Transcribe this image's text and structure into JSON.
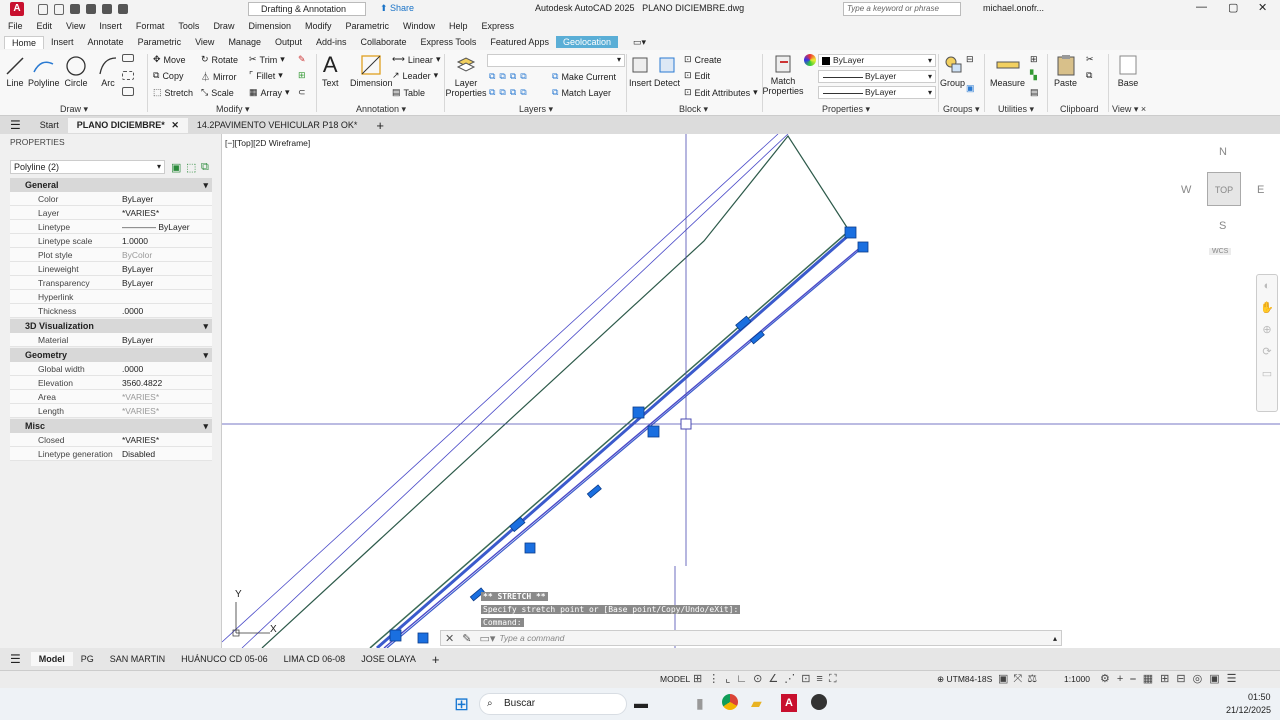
{
  "title": {
    "app_title": "Autodesk AutoCAD 2025",
    "file_name": "PLANO DICIEMBRE.dwg",
    "workspace": "Drafting & Annotation",
    "share": "Share",
    "search_placeholder": "Type a keyword or phrase",
    "user": "michael.onofr..."
  },
  "menu": [
    "File",
    "Edit",
    "View",
    "Insert",
    "Format",
    "Tools",
    "Draw",
    "Dimension",
    "Modify",
    "Parametric",
    "Window",
    "Help",
    "Express"
  ],
  "ribbon_tabs": [
    "Home",
    "Insert",
    "Annotate",
    "Parametric",
    "View",
    "Manage",
    "Output",
    "Add-ins",
    "Collaborate",
    "Express Tools",
    "Featured Apps",
    "Geolocation"
  ],
  "ribbon": {
    "draw": {
      "line": "Line",
      "polyline": "Polyline",
      "circle": "Circle",
      "arc": "Arc",
      "label": "Draw"
    },
    "modify": {
      "move": "Move",
      "rotate": "Rotate",
      "trim": "Trim",
      "copy": "Copy",
      "mirror": "Mirror",
      "fillet": "Fillet",
      "stretch": "Stretch",
      "scale": "Scale",
      "array": "Array",
      "label": "Modify"
    },
    "annotation": {
      "text": "Text",
      "dimension": "Dimension",
      "linear": "Linear",
      "leader": "Leader",
      "table": "Table",
      "label": "Annotation"
    },
    "layers": {
      "layer_properties": "Layer Properties",
      "make_current": "Make Current",
      "match_layer": "Match Layer",
      "label": "Layers"
    },
    "block": {
      "insert": "Insert",
      "detect": "Detect",
      "create": "Create",
      "edit": "Edit",
      "edit_attributes": "Edit Attributes",
      "label": "Block"
    },
    "properties": {
      "match_properties": "Match Properties",
      "color": "ByLayer",
      "linetype": "ByLayer",
      "lineweight": "ByLayer",
      "label": "Properties"
    },
    "groups": {
      "group": "Group",
      "label": "Groups"
    },
    "utilities": {
      "measure": "Measure",
      "label": "Utilities"
    },
    "clipboard": {
      "paste": "Paste",
      "label": "Clipboard"
    },
    "view": {
      "base": "Base",
      "label": "View"
    }
  },
  "doc_tabs": [
    "Start",
    "PLANO DICIEMBRE*",
    "14.2PAVIMENTO VEHICULAR P18 OK*"
  ],
  "properties_panel": {
    "title": "PROPERTIES",
    "selection": "Polyline (2)",
    "sections": [
      {
        "name": "General",
        "rows": [
          [
            "Color",
            "ByLayer"
          ],
          [
            "Layer",
            "*VARIES*"
          ],
          [
            "Linetype",
            "———— ByLayer"
          ],
          [
            "Linetype scale",
            "1.0000"
          ],
          [
            "Plot style",
            "ByColor"
          ],
          [
            "Lineweight",
            "ByLayer"
          ],
          [
            "Transparency",
            "ByLayer"
          ],
          [
            "Hyperlink",
            ""
          ],
          [
            "Thickness",
            ".0000"
          ]
        ]
      },
      {
        "name": "3D Visualization",
        "rows": [
          [
            "Material",
            "ByLayer"
          ]
        ]
      },
      {
        "name": "Geometry",
        "rows": [
          [
            "Global width",
            ".0000"
          ],
          [
            "Elevation",
            "3560.4822"
          ],
          [
            "Area",
            "*VARIES*"
          ],
          [
            "Length",
            "*VARIES*"
          ]
        ]
      },
      {
        "name": "Misc",
        "rows": [
          [
            "Closed",
            "*VARIES*"
          ],
          [
            "Linetype generation",
            "Disabled"
          ]
        ]
      }
    ]
  },
  "viewport_label": "[−][Top][2D Wireframe]",
  "viewcube": {
    "n": "N",
    "s": "S",
    "e": "E",
    "w": "W",
    "top": "TOP",
    "wcs": "WCS"
  },
  "ucs": {
    "y": "Y",
    "x": "X"
  },
  "command": {
    "line1": "** STRETCH **",
    "line2": "Specify stretch point or [Base point/Copy/Undo/eXit]:",
    "line3": "Command:",
    "placeholder": "Type a command"
  },
  "model_tabs": [
    "Model",
    "PG",
    "SAN MARTIN",
    "HUÁNUCO CD 05-06",
    "LIMA CD 06-08",
    "JOSE OLAYA"
  ],
  "status": {
    "model": "MODEL",
    "coords": "UTM84-18S",
    "scale": "1:1000"
  },
  "taskbar": {
    "search": "Buscar",
    "time": "01:50",
    "date": "21/12/2025"
  }
}
